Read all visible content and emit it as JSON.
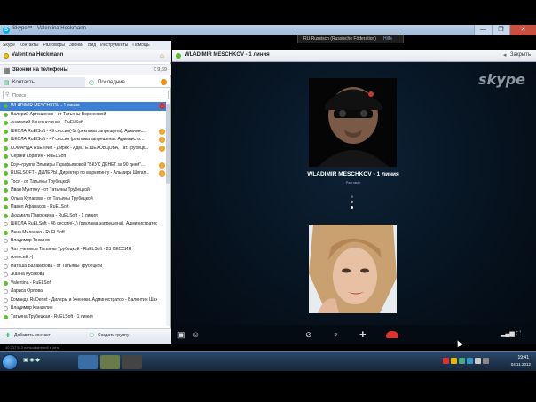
{
  "window": {
    "title": "Skype™ - Valentina Heckmann",
    "controls": [
      "—",
      "❐",
      "✕"
    ]
  },
  "lang_bar": {
    "text": "RU Russisch (Russische Föderation)",
    "tag": "Hilfe"
  },
  "menubar": {
    "items": [
      "Skype",
      "Контакты",
      "Разговоры",
      "Звонки",
      "Вид",
      "Инструменты",
      "Помощь"
    ]
  },
  "user": {
    "name": "Valentina Heckmann",
    "status_color": "#f5c400"
  },
  "phone": {
    "label": "Звонки на телефоны",
    "balance": "€ 9,69"
  },
  "tabs": {
    "contacts": "Контакты",
    "recent": "Последние"
  },
  "search": {
    "placeholder": "Поиск"
  },
  "contacts": [
    {
      "name": "WLADIMIR MESCHKOV - 1 линия",
      "status": "online",
      "badge": "1",
      "selected": true
    },
    {
      "name": "Валерий Артюшенко - от Татьяны Воронковой",
      "status": "online",
      "badge": ""
    },
    {
      "name": "Анатолий Конесниченко - RuELSoft",
      "status": "online",
      "badge": ""
    },
    {
      "name": "ШКОЛА RuElSoft - 49 сессия(-1) (реклама запрещена). Админис...",
      "status": "online",
      "badge": "2"
    },
    {
      "name": "ШКОЛА RuElSoft - 47 сессия (реклама запрещена). Администр...",
      "status": "online",
      "badge": "2"
    },
    {
      "name": "КОМАНДА RuEelNet - Дирек - Адм.: Е.ШЕХОВЦОВА, Тат.Трубецк...",
      "status": "online",
      "badge": "2"
    },
    {
      "name": "Сергей Корягин - RuELSoft",
      "status": "online",
      "badge": ""
    },
    {
      "name": "Коуч-группа Эльвиры Гарифьяновой \"ВКУС ДЕНЕГ за 90 дней\"...",
      "status": "online",
      "badge": "2"
    },
    {
      "name": "RUELSOFT - ДИЛЕРЫ. Директор по маркетингу - Альмира Шигап...",
      "status": "online",
      "badge": "2"
    },
    {
      "name": "Тося - от Татьяны Трубецкой",
      "status": "online",
      "badge": ""
    },
    {
      "name": "Иван Мунтяну - от Татьяны Трубецкой",
      "status": "online",
      "badge": ""
    },
    {
      "name": "Ольга Кулакова - от Татьяны Трубецкой",
      "status": "online",
      "badge": ""
    },
    {
      "name": "Павел Афанасов - RuELSoft",
      "status": "online",
      "badge": ""
    },
    {
      "name": "Людмила Паврюкина - RuELSoft - 1 линия",
      "status": "online",
      "badge": ""
    },
    {
      "name": "ШКОЛА RuELSoft - 46 сессия(-1) (реклама запрещена). Администратор RuELSoft",
      "status": "offline",
      "badge": ""
    },
    {
      "name": "Инна Милашко - RuELSoft",
      "status": "online",
      "badge": ""
    },
    {
      "name": "Владимир Токарев",
      "status": "offline",
      "badge": ""
    },
    {
      "name": "Чат учеников Татьяны Трубецкой - RuELSoft - 23 СЕССИЯ",
      "status": "offline",
      "badge": ""
    },
    {
      "name": "Алексей :-)",
      "status": "offline",
      "badge": ""
    },
    {
      "name": "Наташа Балакирова - от Татьяны Трубецкой",
      "status": "offline",
      "badge": ""
    },
    {
      "name": "Жанна Кусакова",
      "status": "offline",
      "badge": ""
    },
    {
      "name": "Valentina - RuELSoft",
      "status": "online",
      "badge": ""
    },
    {
      "name": "Лариса Орлова",
      "status": "offline",
      "badge": ""
    },
    {
      "name": "Команда RuDenet - Дилеры и Ученики. Администратор - Валентин Шаховский",
      "status": "offline",
      "badge": ""
    },
    {
      "name": "Владимир Канцелин",
      "status": "offline",
      "badge": ""
    },
    {
      "name": "Татьяна Трубецкая - RuELSoft - 1 линия",
      "status": "online",
      "badge": ""
    }
  ],
  "footer": {
    "add_contact": "Добавить контакт",
    "create_group": "Создать группу"
  },
  "call": {
    "header_name": "WLADIMIR MESCHKOV - 1 линия",
    "close_label": "Закрыть",
    "caller_name": "WLADIMIR MESCHKOV - 1 линия",
    "caller_status": "Разговор",
    "logo": "skype"
  },
  "taskbar": {
    "time": "19:41",
    "date": "04.11.2012"
  },
  "status_strip": "40 237 513 пользователей в сети"
}
